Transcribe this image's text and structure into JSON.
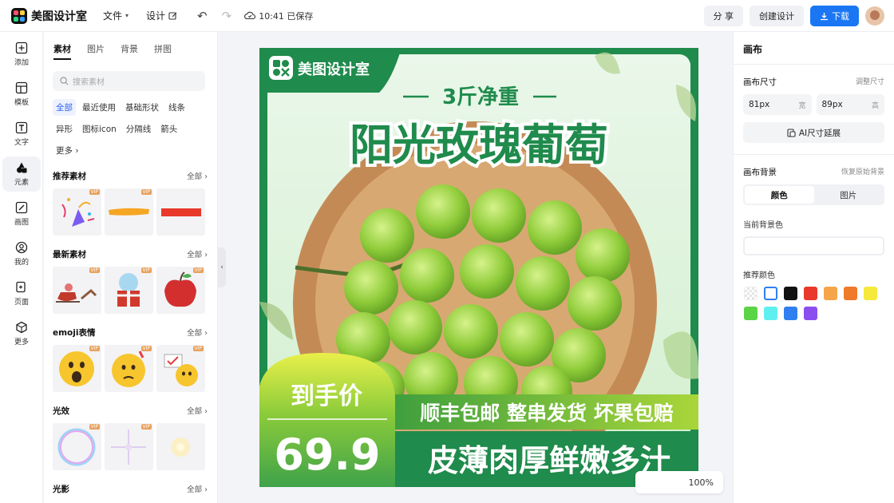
{
  "app": {
    "name": "美图设计室"
  },
  "topbar": {
    "file_label": "文件",
    "design_label": "设计",
    "saved_text": "10:41 已保存",
    "share_label": "分 享",
    "create_label": "创建设计",
    "download_label": "下载"
  },
  "rail": {
    "items": [
      {
        "label": "添加",
        "icon": "plus-icon"
      },
      {
        "label": "模板",
        "icon": "template-icon"
      },
      {
        "label": "文字",
        "icon": "text-icon"
      },
      {
        "label": "元素",
        "icon": "elements-icon"
      },
      {
        "label": "画图",
        "icon": "draw-icon"
      },
      {
        "label": "我的",
        "icon": "user-icon"
      },
      {
        "label": "页面",
        "icon": "page-icon"
      },
      {
        "label": "更多",
        "icon": "more-icon"
      }
    ]
  },
  "panel": {
    "tabs": [
      "素材",
      "图片",
      "背景",
      "拼图"
    ],
    "search_placeholder": "搜索素材",
    "chips": [
      "全部",
      "最近使用",
      "基础形状",
      "线条",
      "异形",
      "图标icon",
      "分隔线",
      "箭头",
      "更多"
    ],
    "sections": [
      {
        "title": "推荐素材",
        "all": "全部"
      },
      {
        "title": "最新素材",
        "all": "全部"
      },
      {
        "title": "emoji表情",
        "all": "全部"
      },
      {
        "title": "光效",
        "all": "全部"
      },
      {
        "title": "光影",
        "all": "全部"
      }
    ],
    "vip_badge": "VIP"
  },
  "canvas": {
    "brand": "美图设计室",
    "weight": "3斤净重",
    "product": "阳光玫瑰葡萄",
    "price_label": "到手价",
    "price": "69.9",
    "features": "顺丰包邮 整串发货 坏果包赔",
    "slogan": "皮薄肉厚鲜嫩多汁",
    "zoom": "100%"
  },
  "right_panel": {
    "title": "画布",
    "size_label": "画布尺寸",
    "adjust_size": "调整尺寸",
    "width_value": "81px",
    "width_unit": "宽",
    "height_value": "89px",
    "height_unit": "高",
    "ai_extend": "AI尺寸延展",
    "bg_label": "画布背景",
    "restore_bg": "恢复原始背景",
    "seg_color": "颜色",
    "seg_image": "图片",
    "current_bg": "当前背景色",
    "recommended": "推荐颜色",
    "colors": [
      "transparent",
      "#ffffff",
      "#111111",
      "#e8392b",
      "#f5a54a",
      "#ef7a2a",
      "#f5ea3c",
      "#5bd445",
      "#5ef0ee",
      "#2f7ff0",
      "#8b4ff0"
    ]
  }
}
